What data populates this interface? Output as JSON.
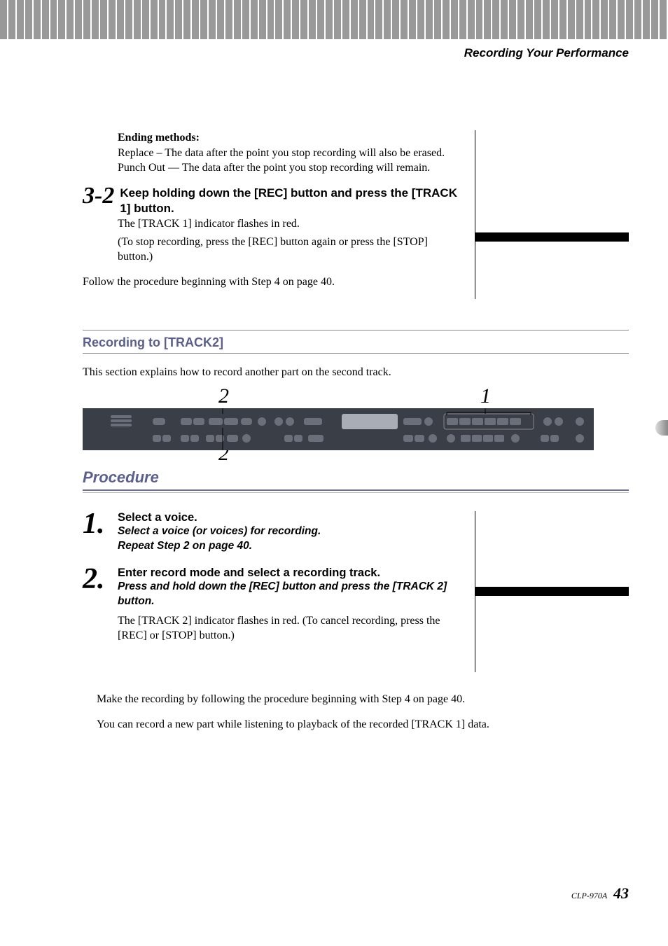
{
  "header_title": "Recording Your Performance",
  "ending": {
    "heading": "Ending methods:",
    "replace": "Replace – The data after the point you stop recording will also be erased.",
    "punchout": "Punch Out — The data after the point you stop recording will remain."
  },
  "step32": {
    "num": "3-2",
    "title": "Keep holding down the [REC] button and press the [TRACK 1] button.",
    "line1": "The [TRACK 1] indicator flashes in red.",
    "line2": "(To stop recording, press the [REC] button again or press the [STOP] button.)",
    "follow": "Follow the procedure beginning with Step 4 on page 40."
  },
  "section": {
    "title": "Recording to [TRACK2]",
    "intro": "This section explains how to record another part on the second track."
  },
  "panel": {
    "label_top_2": "2",
    "label_bottom_2": "2",
    "label_1": "1"
  },
  "procedure_heading": "Procedure",
  "steps": {
    "s1": {
      "num": "1.",
      "title": "Select a voice.",
      "sub1": "Select a voice (or voices) for recording.",
      "sub2": "Repeat Step 2 on page 40."
    },
    "s2": {
      "num": "2.",
      "title": "Enter record mode and select a recording track.",
      "sub1": "Press and hold down the [REC] button and press the [TRACK 2] button.",
      "detail": "The [TRACK 2] indicator flashes in red. (To cancel recording, press the [REC] or [STOP] button.)"
    }
  },
  "tail": {
    "line1": "Make the recording by following the procedure beginning with Step 4 on page 40.",
    "line2": "You can record a new part while listening to playback of the recorded [TRACK 1] data."
  },
  "footer": {
    "model": "CLP-970A",
    "page": "43"
  }
}
